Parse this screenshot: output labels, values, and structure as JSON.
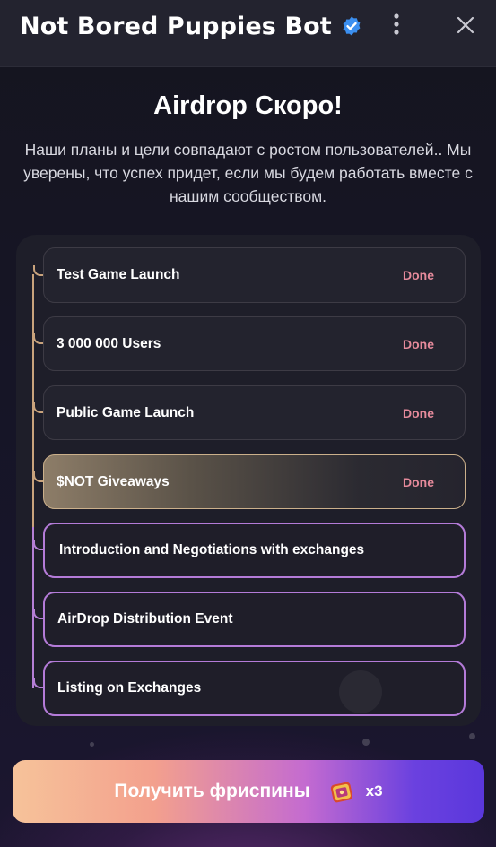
{
  "header": {
    "title": "Not Bored Puppies Bot",
    "verified_icon": "verified-badge-icon",
    "menu_icon": "more-vertical-icon",
    "close_icon": "close-icon"
  },
  "main": {
    "headline": "Airdrop Скоро!",
    "description": "Наши планы и цели совпадают с ростом пользователей.. Мы уверены, что успех придет, если мы будем работать вместе с нашим сообществом."
  },
  "roadmap": {
    "steps": [
      {
        "label": "Test Game Launch",
        "status": "Done",
        "state": "done"
      },
      {
        "label": "3 000 000 Users",
        "status": "Done",
        "state": "done"
      },
      {
        "label": "Public Game Launch",
        "status": "Done",
        "state": "done"
      },
      {
        "label": "$NOT Giveaways",
        "status": "Done",
        "state": "active"
      },
      {
        "label": "Introduction and Negotiations with exchanges",
        "status": "",
        "state": "future"
      },
      {
        "label": "AirDrop Distribution Event",
        "status": "",
        "state": "future"
      },
      {
        "label": "Listing on Exchanges",
        "status": "",
        "state": "future"
      }
    ]
  },
  "cta": {
    "label": "Получить фриспины",
    "icon": "treasure-chest-icon",
    "count": "x3"
  },
  "colors": {
    "done_status": "#e58a9b",
    "future_border": "#b47bd8",
    "active_border": "#cbb08b"
  }
}
